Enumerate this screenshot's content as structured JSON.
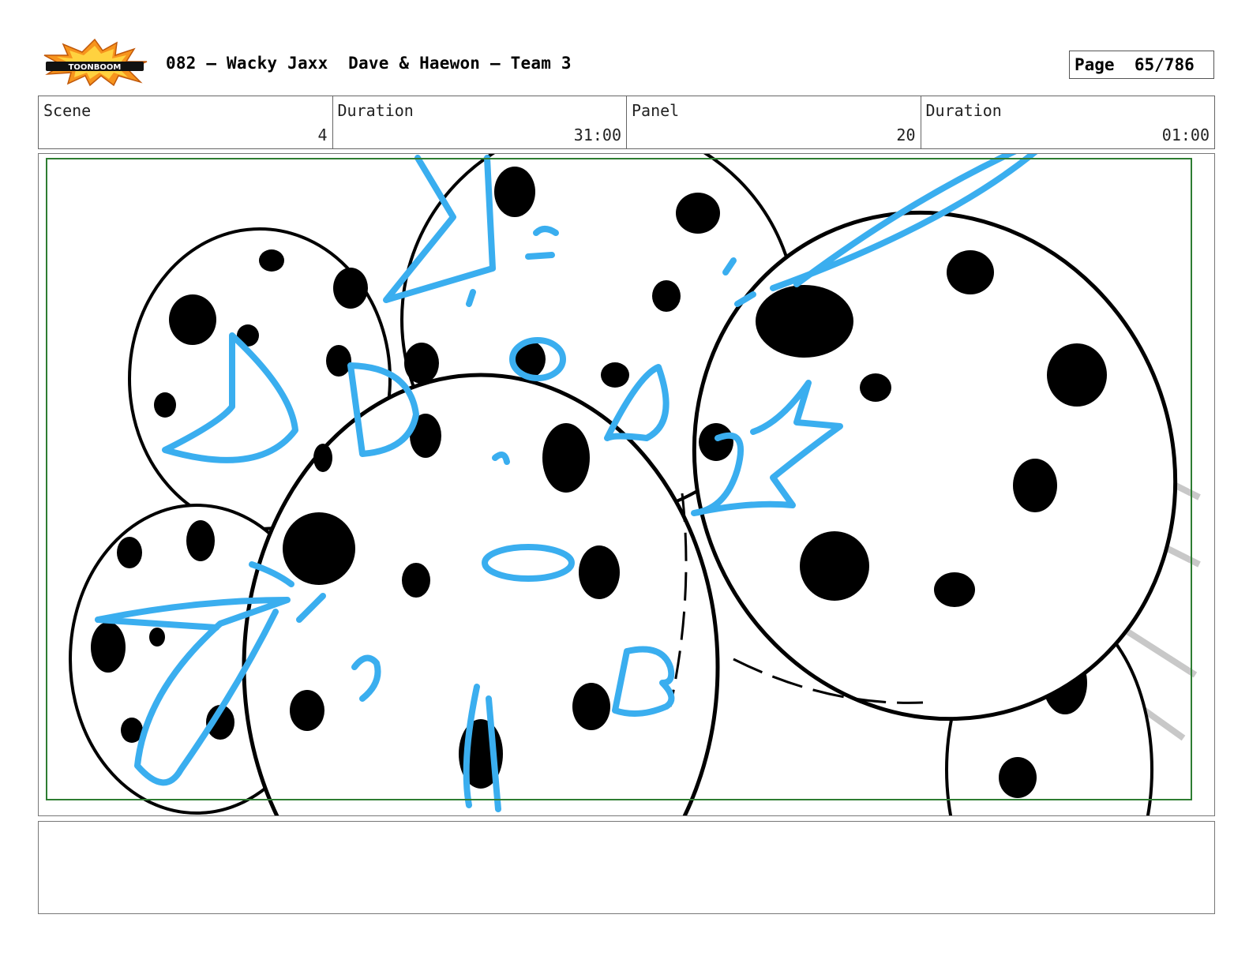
{
  "header": {
    "logo_text": "TOONBOOM",
    "title": "082 – Wacky Jaxx  Dave & Haewon – Team 3",
    "page_label": "Page",
    "page_value": "65/786"
  },
  "info": {
    "scene_label": "Scene",
    "scene_value": "4",
    "scene_duration_label": "Duration",
    "scene_duration_value": "31:00",
    "panel_label": "Panel",
    "panel_value": "20",
    "panel_duration_label": "Duration",
    "panel_duration_value": "01:00"
  },
  "colors": {
    "sketch_blue": "#3aaeef",
    "safe_frame_green": "#2e7d32",
    "ink_black": "#000000",
    "speed_line_gray": "#c8c8c8",
    "logo_orange": "#f7941d"
  },
  "notes": {
    "text": ""
  }
}
